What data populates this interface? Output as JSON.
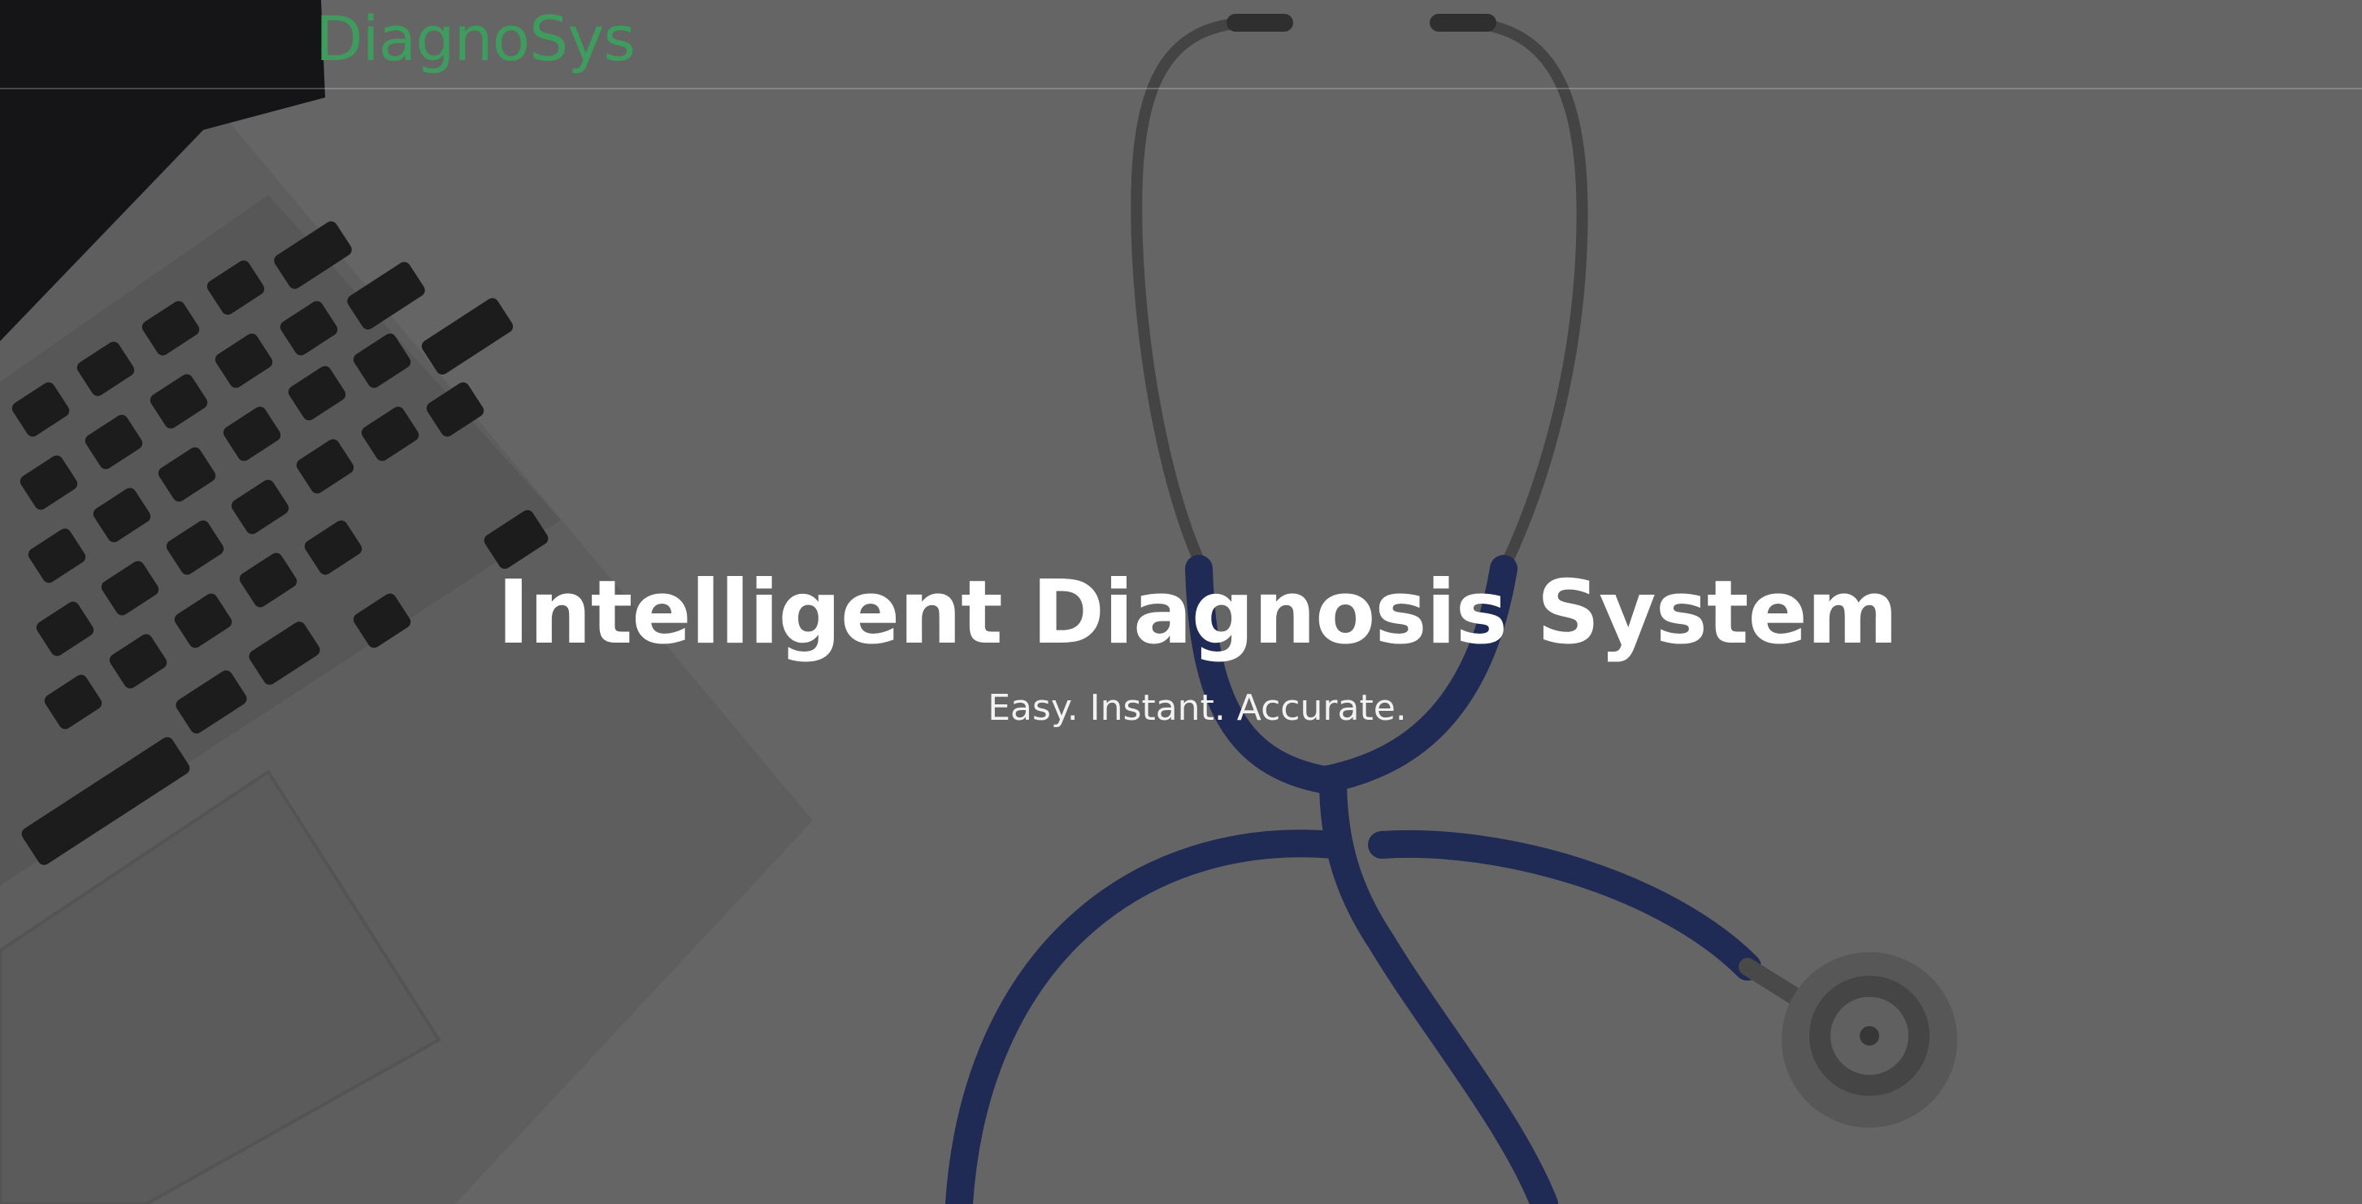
{
  "navbar": {
    "brand": "DiagnoSys"
  },
  "hero": {
    "title": "Intelligent Diagnosis System",
    "subtitle": "Easy. Instant. Accurate."
  },
  "colors": {
    "brand": "#3f9c5e",
    "text": "#ffffff",
    "stethoscope_tube": "#2a47b8"
  },
  "background": {
    "image_subject": [
      "laptop",
      "stethoscope"
    ]
  }
}
